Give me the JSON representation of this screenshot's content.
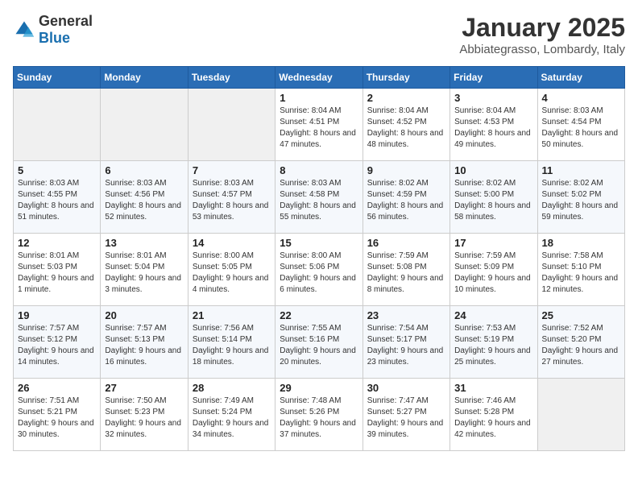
{
  "logo": {
    "general": "General",
    "blue": "Blue"
  },
  "title": "January 2025",
  "subtitle": "Abbiategrasso, Lombardy, Italy",
  "days_of_week": [
    "Sunday",
    "Monday",
    "Tuesday",
    "Wednesday",
    "Thursday",
    "Friday",
    "Saturday"
  ],
  "weeks": [
    [
      {
        "day": "",
        "info": ""
      },
      {
        "day": "",
        "info": ""
      },
      {
        "day": "",
        "info": ""
      },
      {
        "day": "1",
        "info": "Sunrise: 8:04 AM\nSunset: 4:51 PM\nDaylight: 8 hours and 47 minutes."
      },
      {
        "day": "2",
        "info": "Sunrise: 8:04 AM\nSunset: 4:52 PM\nDaylight: 8 hours and 48 minutes."
      },
      {
        "day": "3",
        "info": "Sunrise: 8:04 AM\nSunset: 4:53 PM\nDaylight: 8 hours and 49 minutes."
      },
      {
        "day": "4",
        "info": "Sunrise: 8:03 AM\nSunset: 4:54 PM\nDaylight: 8 hours and 50 minutes."
      }
    ],
    [
      {
        "day": "5",
        "info": "Sunrise: 8:03 AM\nSunset: 4:55 PM\nDaylight: 8 hours and 51 minutes."
      },
      {
        "day": "6",
        "info": "Sunrise: 8:03 AM\nSunset: 4:56 PM\nDaylight: 8 hours and 52 minutes."
      },
      {
        "day": "7",
        "info": "Sunrise: 8:03 AM\nSunset: 4:57 PM\nDaylight: 8 hours and 53 minutes."
      },
      {
        "day": "8",
        "info": "Sunrise: 8:03 AM\nSunset: 4:58 PM\nDaylight: 8 hours and 55 minutes."
      },
      {
        "day": "9",
        "info": "Sunrise: 8:02 AM\nSunset: 4:59 PM\nDaylight: 8 hours and 56 minutes."
      },
      {
        "day": "10",
        "info": "Sunrise: 8:02 AM\nSunset: 5:00 PM\nDaylight: 8 hours and 58 minutes."
      },
      {
        "day": "11",
        "info": "Sunrise: 8:02 AM\nSunset: 5:02 PM\nDaylight: 8 hours and 59 minutes."
      }
    ],
    [
      {
        "day": "12",
        "info": "Sunrise: 8:01 AM\nSunset: 5:03 PM\nDaylight: 9 hours and 1 minute."
      },
      {
        "day": "13",
        "info": "Sunrise: 8:01 AM\nSunset: 5:04 PM\nDaylight: 9 hours and 3 minutes."
      },
      {
        "day": "14",
        "info": "Sunrise: 8:00 AM\nSunset: 5:05 PM\nDaylight: 9 hours and 4 minutes."
      },
      {
        "day": "15",
        "info": "Sunrise: 8:00 AM\nSunset: 5:06 PM\nDaylight: 9 hours and 6 minutes."
      },
      {
        "day": "16",
        "info": "Sunrise: 7:59 AM\nSunset: 5:08 PM\nDaylight: 9 hours and 8 minutes."
      },
      {
        "day": "17",
        "info": "Sunrise: 7:59 AM\nSunset: 5:09 PM\nDaylight: 9 hours and 10 minutes."
      },
      {
        "day": "18",
        "info": "Sunrise: 7:58 AM\nSunset: 5:10 PM\nDaylight: 9 hours and 12 minutes."
      }
    ],
    [
      {
        "day": "19",
        "info": "Sunrise: 7:57 AM\nSunset: 5:12 PM\nDaylight: 9 hours and 14 minutes."
      },
      {
        "day": "20",
        "info": "Sunrise: 7:57 AM\nSunset: 5:13 PM\nDaylight: 9 hours and 16 minutes."
      },
      {
        "day": "21",
        "info": "Sunrise: 7:56 AM\nSunset: 5:14 PM\nDaylight: 9 hours and 18 minutes."
      },
      {
        "day": "22",
        "info": "Sunrise: 7:55 AM\nSunset: 5:16 PM\nDaylight: 9 hours and 20 minutes."
      },
      {
        "day": "23",
        "info": "Sunrise: 7:54 AM\nSunset: 5:17 PM\nDaylight: 9 hours and 23 minutes."
      },
      {
        "day": "24",
        "info": "Sunrise: 7:53 AM\nSunset: 5:19 PM\nDaylight: 9 hours and 25 minutes."
      },
      {
        "day": "25",
        "info": "Sunrise: 7:52 AM\nSunset: 5:20 PM\nDaylight: 9 hours and 27 minutes."
      }
    ],
    [
      {
        "day": "26",
        "info": "Sunrise: 7:51 AM\nSunset: 5:21 PM\nDaylight: 9 hours and 30 minutes."
      },
      {
        "day": "27",
        "info": "Sunrise: 7:50 AM\nSunset: 5:23 PM\nDaylight: 9 hours and 32 minutes."
      },
      {
        "day": "28",
        "info": "Sunrise: 7:49 AM\nSunset: 5:24 PM\nDaylight: 9 hours and 34 minutes."
      },
      {
        "day": "29",
        "info": "Sunrise: 7:48 AM\nSunset: 5:26 PM\nDaylight: 9 hours and 37 minutes."
      },
      {
        "day": "30",
        "info": "Sunrise: 7:47 AM\nSunset: 5:27 PM\nDaylight: 9 hours and 39 minutes."
      },
      {
        "day": "31",
        "info": "Sunrise: 7:46 AM\nSunset: 5:28 PM\nDaylight: 9 hours and 42 minutes."
      },
      {
        "day": "",
        "info": ""
      }
    ]
  ]
}
